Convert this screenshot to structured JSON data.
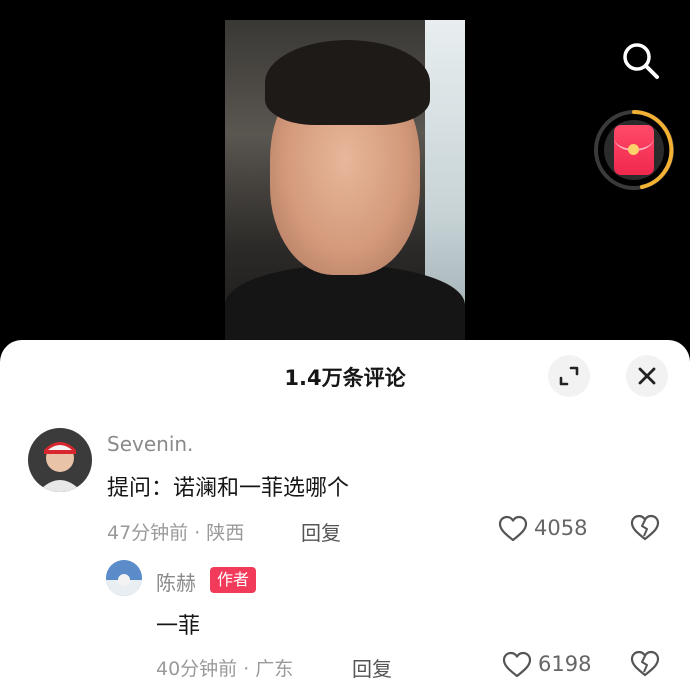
{
  "header": {
    "comments_title": "1.4万条评论"
  },
  "comment": {
    "username": "Sevenin.",
    "text": "提问：诺澜和一菲选哪个",
    "meta": "47分钟前 · 陕西",
    "reply_label": "回复",
    "likes": "4058"
  },
  "reply": {
    "username": "陈赫",
    "badge": "作者",
    "text": "一菲",
    "meta": "40分钟前 · 广东",
    "reply_label": "回复",
    "likes": "6198"
  },
  "colors": {
    "accent": "#f23a5b",
    "redpacket": "#f0284e",
    "ring": "#f2b035"
  },
  "icons": {
    "search": "search-icon",
    "redpacket": "red-packet-icon",
    "expand": "expand-icon",
    "close": "close-icon",
    "like": "heart-icon",
    "dislike": "broken-heart-icon"
  }
}
